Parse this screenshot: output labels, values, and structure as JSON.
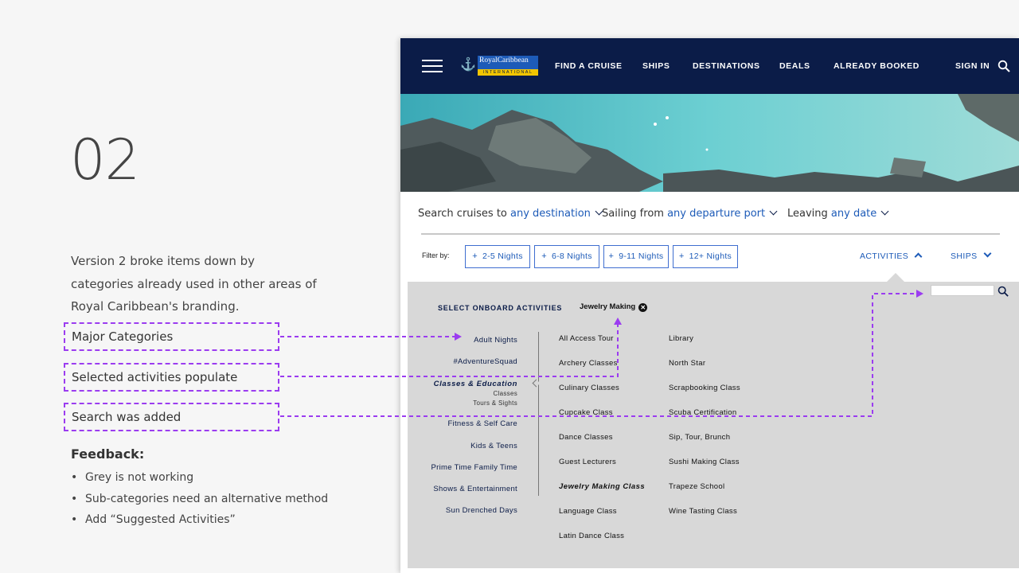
{
  "slide": {
    "number": "02",
    "intro": "Version 2 broke items down by categories already used in other areas of Royal Caribbean's branding.",
    "callouts": [
      "Major Categories",
      "Selected activities populate",
      "Search was added"
    ],
    "feedback_title": "Feedback:",
    "feedback_items": [
      "Grey is not working",
      "Sub-categories need an alternative method",
      "Add “Suggested Activities”"
    ],
    "annotation_color": "#9b3cf0"
  },
  "site": {
    "brand_name": "RoyalCaribbean",
    "brand_sub": "INTERNATIONAL",
    "brand_colors": {
      "navy": "#0b1c48",
      "blue": "#1d5bb8",
      "gold": "#f2c500"
    },
    "nav": [
      "FIND A CRUISE",
      "SHIPS",
      "DESTINATIONS",
      "DEALS",
      "ALREADY BOOKED",
      "SIGN IN"
    ],
    "search": {
      "search_label": "Search cruises to",
      "destination": "any destination",
      "sailing_label": "Sailing from",
      "port": "any departure port",
      "leaving_label": "Leaving",
      "date": "any date"
    },
    "filter": {
      "label": "Filter by:",
      "pills": [
        "2-5 Nights",
        "6-8 Nights",
        "9-11 Nights",
        "12+ Nights"
      ],
      "activities": "ACTIVITIES",
      "ships": "SHIPS"
    },
    "panel": {
      "title": "SELECT ONBOARD ACTIVITIES",
      "selected_chip": "Jewelry Making",
      "categories": [
        "Adult Nights",
        "#AdventureSquad",
        "Classes & Education",
        "Fitness & Self Care",
        "Kids & Teens",
        "Prime Time Family Time",
        "Shows & Entertainment",
        "Sun Drenched Days"
      ],
      "subcategories": [
        "Classes",
        "Tours & Sights"
      ],
      "activities_col1": [
        "All Access Tour",
        "Archery Classes",
        "Culinary Classes",
        "Cupcake Class",
        "Dance Classes",
        "Guest Lecturers",
        "Jewelry Making Class",
        "Language Class",
        "Latin Dance Class"
      ],
      "activities_col2": [
        "Library",
        "North Star",
        "Scrapbooking Class",
        "Scuba Certification",
        "Sip, Tour, Brunch",
        "Sushi Making Class",
        "Trapeze School",
        "Wine Tasting Class"
      ]
    }
  }
}
